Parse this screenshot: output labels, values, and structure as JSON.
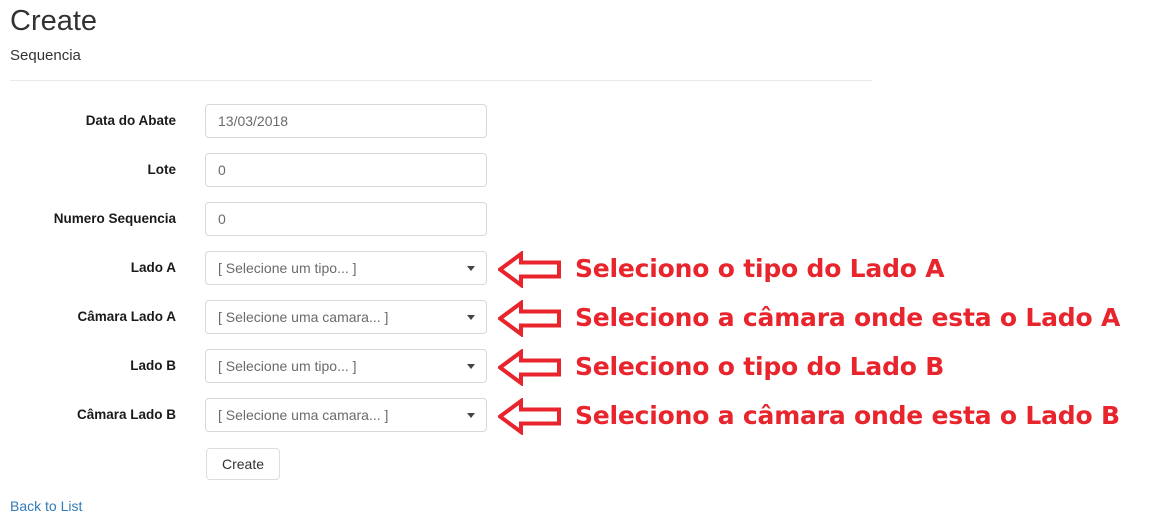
{
  "header": {
    "title": "Create",
    "subtitle": "Sequencia"
  },
  "colors": {
    "annotation_red": "#e8242c",
    "link_blue": "#337ab7",
    "label_text": "#1a1a1a",
    "input_border": "#d8d8d8",
    "rule": "#e9e9e9"
  },
  "form": {
    "fields": [
      {
        "label": "Data do Abate",
        "type": "text",
        "value": "13/03/2018",
        "name": "data-do-abate"
      },
      {
        "label": "Lote",
        "type": "text",
        "value": "0",
        "name": "lote"
      },
      {
        "label": "Numero Sequencia",
        "type": "text",
        "value": "0",
        "name": "numero-sequencia"
      },
      {
        "label": "Lado A",
        "type": "select",
        "value": "[ Selecione um tipo... ]",
        "name": "lado-a"
      },
      {
        "label": "Câmara Lado A",
        "type": "select",
        "value": "[ Selecione uma camara... ]",
        "name": "camara-lado-a"
      },
      {
        "label": "Lado B",
        "type": "select",
        "value": "[ Selecione um tipo... ]",
        "name": "lado-b"
      },
      {
        "label": "Câmara Lado B",
        "type": "select",
        "value": "[ Selecione uma camara... ]",
        "name": "camara-lado-b"
      }
    ],
    "submit_label": "Create",
    "back_link_label": "Back to List"
  },
  "annotations": [
    {
      "text": "Seleciono o tipo do Lado A",
      "icon": "left-arrow-icon"
    },
    {
      "text": "Seleciono a câmara onde esta o Lado A",
      "icon": "left-arrow-icon"
    },
    {
      "text": "Seleciono o tipo do Lado B",
      "icon": "left-arrow-icon"
    },
    {
      "text": "Seleciono a câmara onde esta o Lado B",
      "icon": "left-arrow-icon"
    }
  ]
}
